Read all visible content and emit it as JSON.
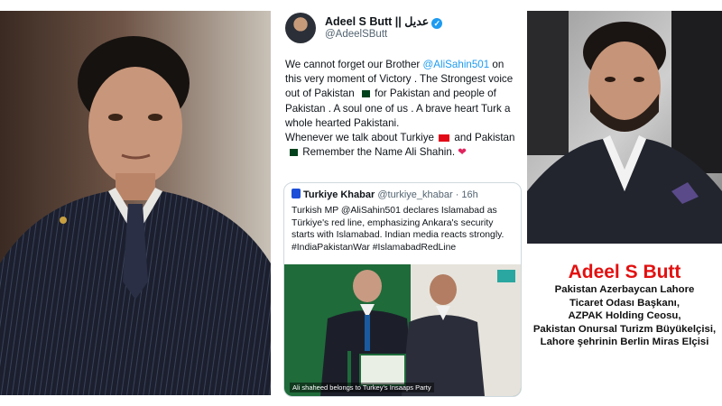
{
  "tweet": {
    "display_name": "Adeel S Butt || عدیل",
    "handle": "@AdeelSButt",
    "body": {
      "l1a": "We cannot forget our Brother ",
      "mention": "@AliSahin501",
      "l1b": " on this very moment of Victory . The Strongest voice out of Pakistan ",
      "l2": " for Pakistan and people of Pakistan . A soul one of us . A brave heart Turk a whole hearted Pakistani.",
      "l3a": "Whenever we talk about Turkiye ",
      "l3b": " and Pakistan",
      "l4": " Remember the Name Ali Shahin. ",
      "heart": "❤"
    },
    "quote": {
      "name": "Turkiye Khabar",
      "handle_time": "@turkiye_khabar · 16h",
      "text": "Turkish MP @AliSahin501 declares Islamabad as Türkiye's red line, emphasizing Ankara's security starts with Islamabad. Indian media reacts strongly. #IndiaPakistanWar #IslamabadRedLine",
      "media_caption": "Ali shaheed belongs to Turkey's Insaaps Party"
    }
  },
  "caption": {
    "name": "Adeel S Butt",
    "lines": [
      "Pakistan Azerbaycan Lahore",
      "Ticaret Odası Başkanı,",
      "AZPAK Holding Ceosu,",
      "Pakistan Onursal Turizm Büyükelçisi,",
      "Lahore şehrinin Berlin Miras Elçisi"
    ]
  },
  "icons": {
    "verified": "verified-badge-icon",
    "pakistan_flag": "pakistan-flag-icon",
    "turkey_flag": "turkey-flag-icon"
  },
  "colors": {
    "caption_name": "#e31010",
    "link": "#1d9bf0"
  }
}
